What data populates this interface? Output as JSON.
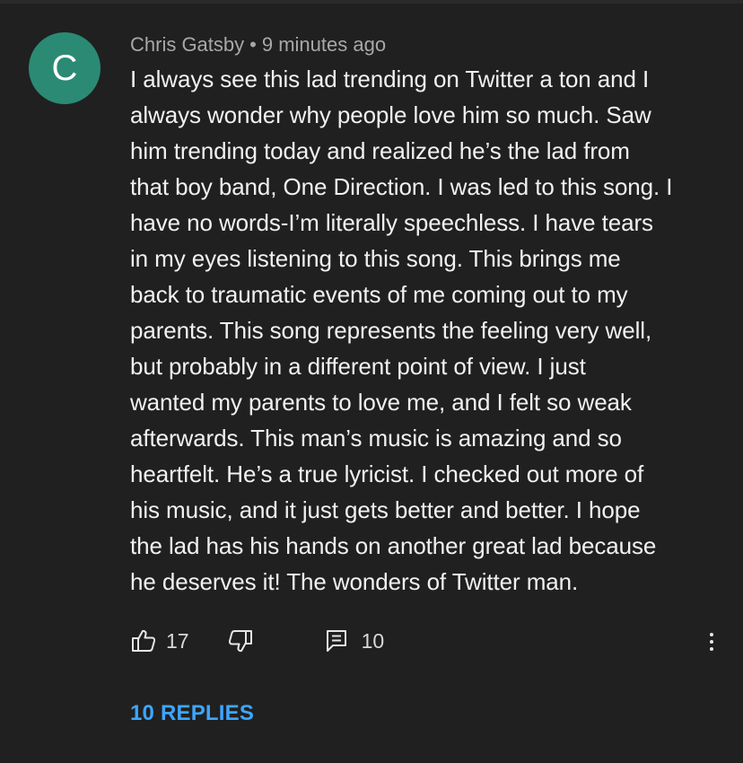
{
  "comment": {
    "avatar_letter": "C",
    "avatar_color": "#2b8a74",
    "author": "Chris Gatsby",
    "separator": "•",
    "timestamp": "9 minutes ago",
    "lines": [
      "I always see this lad trending on Twitter a ton and I",
      "always wonder why people love him so much. Saw",
      "him trending today and realized he’s the lad from",
      "that boy band, One Direction. I was led to this song. I",
      "have no words-I’m literally speechless. I have tears",
      "in my eyes listening to this song. This brings me",
      "back to traumatic events of me coming out to my",
      "parents. This song represents the feeling very well,",
      "but probably in a different point of view. I just",
      "wanted my parents to love me, and I felt so weak",
      "afterwards. This man’s music is amazing and so",
      "heartfelt. He’s a true lyricist. I checked out more of",
      "his music, and it just gets better and better. I hope",
      "the lad has his hands on another great lad because",
      "he deserves it! The wonders of Twitter man."
    ]
  },
  "actions": {
    "like_icon": "thumbs-up-icon",
    "like_count": "17",
    "dislike_icon": "thumbs-down-icon",
    "reply_icon": "comment-icon",
    "reply_count": "10",
    "more_icon": "more-vertical-icon"
  },
  "replies": {
    "label": "10 REPLIES",
    "color": "#3ea6ff"
  }
}
